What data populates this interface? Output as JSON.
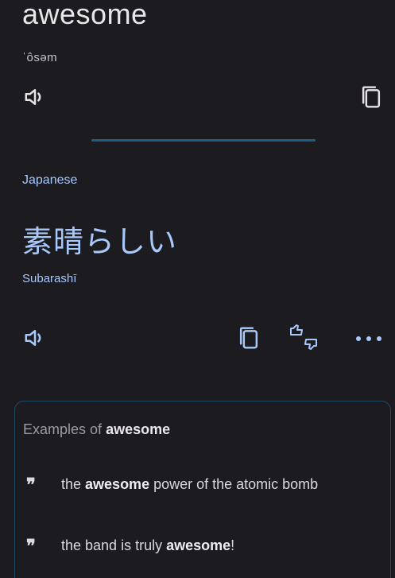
{
  "source": {
    "word": "awesome",
    "phonetic": "ˈôsəm",
    "speak_icon": "speaker-icon",
    "copy_icon": "copy-icon"
  },
  "target": {
    "language": "Japanese",
    "translation": "素晴らしい",
    "romanization": "Subarashī",
    "speak_icon": "speaker-icon",
    "copy_icon": "copy-icon",
    "feedback_icon": "thumbs-up-down-icon",
    "more_icon": "more-horizontal-icon"
  },
  "examples": {
    "title_prefix": "Examples of",
    "title_word": "awesome",
    "items": [
      {
        "before": "the ",
        "highlight": "awesome",
        "after": " power of the atomic bomb"
      },
      {
        "before": "the band is truly ",
        "highlight": "awesome",
        "after": "!"
      }
    ]
  },
  "colors": {
    "background": "#1c1b1f",
    "accent": "#a8c7fa",
    "divider": "#1f5f86",
    "card_border": "#1f4a66"
  }
}
